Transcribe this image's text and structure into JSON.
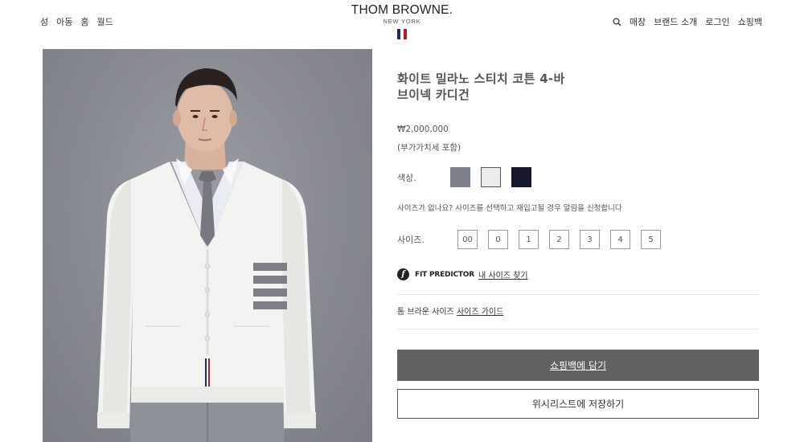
{
  "header": {
    "nav_left": [
      "성",
      "아동",
      "홈",
      "월드"
    ],
    "logo_main": "THOM BROWNE.",
    "logo_sub": "NEW YORK",
    "flag_colors": [
      "#1b2b63",
      "#ffffff",
      "#b11e2b"
    ],
    "search_icon": "search-icon",
    "nav_right": [
      "매장",
      "브랜드 소개",
      "로그인",
      "쇼핑백"
    ]
  },
  "product": {
    "title_line1": "화이트 밀라노 스티치 코튼 4-바",
    "title_line2": "브이넥 카디건",
    "price": "₩2,000,000",
    "vat_note": "(부가가치세 포함)",
    "color_label": "색상.",
    "colors": [
      {
        "name": "grey",
        "hex": "#7d808a"
      },
      {
        "name": "white",
        "hex": "#ececec"
      },
      {
        "name": "navy",
        "hex": "#14182a"
      }
    ],
    "notify_text": "사이즈가 없나요? 사이즈를 선택하고 재입고될 경우 알림을 신청합니다",
    "size_label": "사이즈.",
    "sizes": [
      "00",
      "0",
      "1",
      "2",
      "3",
      "4",
      "5"
    ],
    "fit_icon": "f",
    "fit_label": "FIT PREDICTOR",
    "fit_link": "내 사이즈 찾기",
    "guide_text": "톰 브라운 사이즈",
    "guide_link": "사이즈 가이드",
    "add_to_bag": "쇼핑백에 담기",
    "wishlist": "위시리스트에 저장하기"
  }
}
